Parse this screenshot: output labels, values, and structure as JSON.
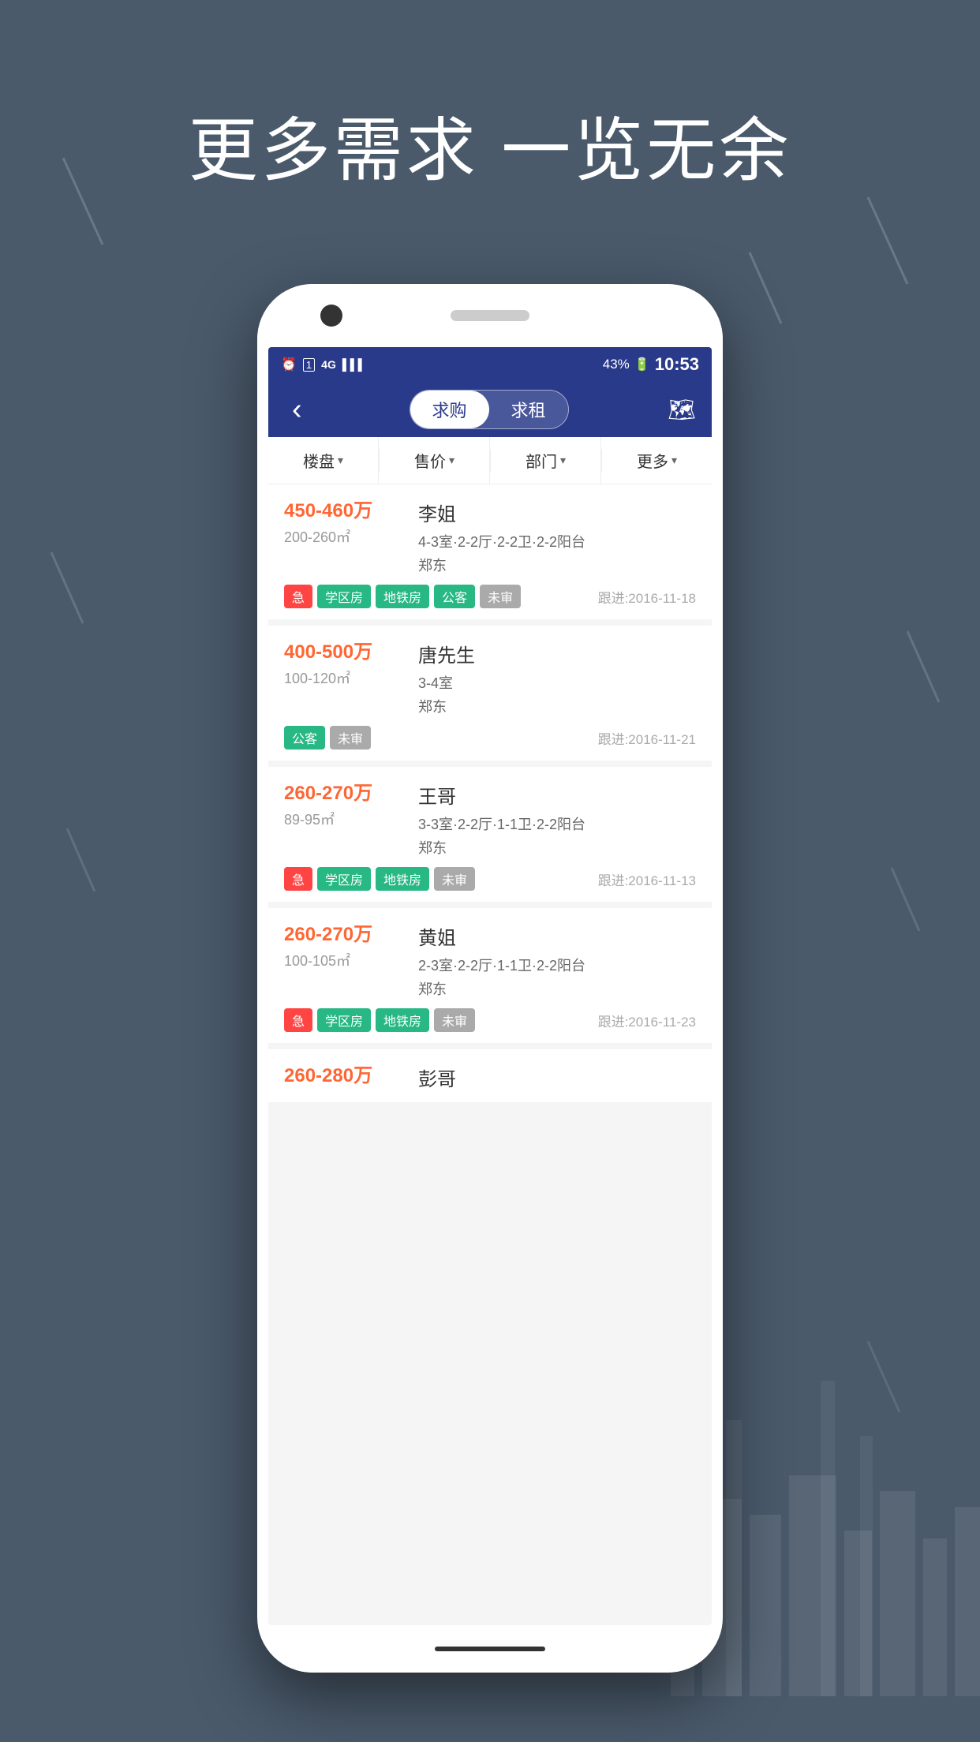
{
  "background": {
    "color": "#4a5a6b"
  },
  "hero": {
    "title": "更多需求 一览无余"
  },
  "status_bar": {
    "alarm_icon": "⏰",
    "sim_icon": "①",
    "network": "4G",
    "signal": "▌▌▌",
    "battery": "43%",
    "time": "10:53"
  },
  "nav": {
    "back_label": "‹",
    "tab_buy": "求购",
    "tab_rent": "求租",
    "map_icon": "🗺"
  },
  "filters": [
    {
      "label": "楼盘",
      "id": "building"
    },
    {
      "label": "售价",
      "id": "price"
    },
    {
      "label": "部门",
      "id": "dept"
    },
    {
      "label": "更多",
      "id": "more"
    }
  ],
  "listings": [
    {
      "price": "450-460万",
      "area": "200-260㎡",
      "name": "李姐",
      "detail": "4-3室·2-2厅·2-2卫·2-2阳台",
      "location": "郑东",
      "tags": [
        {
          "text": "急",
          "type": "urgent"
        },
        {
          "text": "学区房",
          "type": "school"
        },
        {
          "text": "地铁房",
          "type": "metro"
        },
        {
          "text": "公客",
          "type": "public"
        },
        {
          "text": "未审",
          "type": "pending"
        }
      ],
      "follow_date": "跟进:2016-11-18"
    },
    {
      "price": "400-500万",
      "area": "100-120㎡",
      "name": "唐先生",
      "detail": "3-4室",
      "location": "郑东",
      "tags": [
        {
          "text": "公客",
          "type": "public"
        },
        {
          "text": "未审",
          "type": "pending"
        }
      ],
      "follow_date": "跟进:2016-11-21"
    },
    {
      "price": "260-270万",
      "area": "89-95㎡",
      "name": "王哥",
      "detail": "3-3室·2-2厅·1-1卫·2-2阳台",
      "location": "郑东",
      "tags": [
        {
          "text": "急",
          "type": "urgent"
        },
        {
          "text": "学区房",
          "type": "school"
        },
        {
          "text": "地铁房",
          "type": "metro"
        },
        {
          "text": "未审",
          "type": "pending"
        }
      ],
      "follow_date": "跟进:2016-11-13"
    },
    {
      "price": "260-270万",
      "area": "100-105㎡",
      "name": "黄姐",
      "detail": "2-3室·2-2厅·1-1卫·2-2阳台",
      "location": "郑东",
      "tags": [
        {
          "text": "急",
          "type": "urgent"
        },
        {
          "text": "学区房",
          "type": "school"
        },
        {
          "text": "地铁房",
          "type": "metro"
        },
        {
          "text": "未审",
          "type": "pending"
        }
      ],
      "follow_date": "跟进:2016-11-23"
    },
    {
      "price": "260-280万",
      "area": "",
      "name": "彭哥",
      "detail": "",
      "location": "",
      "tags": [],
      "follow_date": ""
    }
  ]
}
